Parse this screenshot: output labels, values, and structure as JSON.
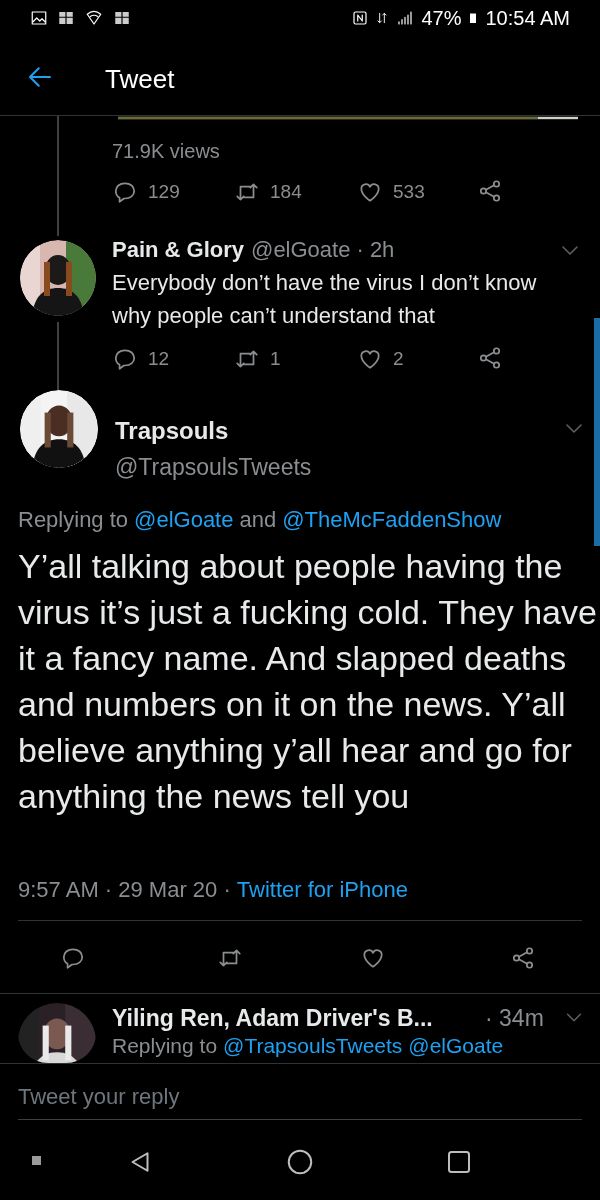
{
  "status_bar": {
    "battery": "47%",
    "time": "10:54 AM"
  },
  "header": {
    "title": "Tweet"
  },
  "parent_tweet": {
    "views": "71.9K views",
    "replies": "129",
    "retweets": "184",
    "likes": "533"
  },
  "reply": {
    "name": "Pain & Glory",
    "handle": "@elGoate",
    "time": "· 2h",
    "text": "Everybody don’t have the virus I don’t know why people can’t understand that",
    "replies": "12",
    "retweets": "1",
    "likes": "2"
  },
  "main_tweet": {
    "name": "Trapsouls",
    "handle": "@TrapsoulsTweets",
    "replying_label": "Replying to",
    "replying_to": [
      "@elGoate",
      "@TheMcFaddenShow"
    ],
    "replying_joiner": "and",
    "text": "Y’all talking about people having the virus it’s just a fucking cold. They have it a fancy name. And slapped deaths and numbers on it on the news. Y’all believe anything y’all hear and go for anything the news tell you",
    "time": "9:57 AM · 29 Mar 20 ·",
    "source": "Twitter for iPhone"
  },
  "next_reply": {
    "name": "Yiling Ren, Adam Driver's B...",
    "time": "· 34m",
    "replying_label": "Replying to",
    "replying_to": [
      "@TrapsoulsTweets",
      "@elGoate"
    ]
  },
  "reply_field": {
    "placeholder": "Tweet your reply"
  }
}
